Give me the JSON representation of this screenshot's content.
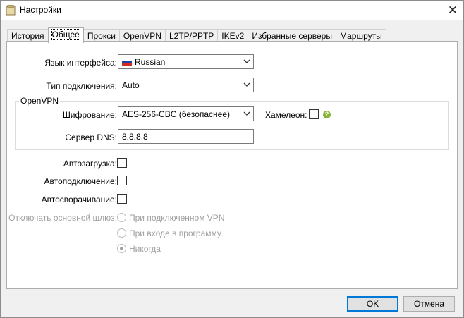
{
  "window": {
    "title": "Настройки",
    "close_glyph": "✕"
  },
  "tabs": [
    {
      "label": "История"
    },
    {
      "label": "Общее"
    },
    {
      "label": "Прокси"
    },
    {
      "label": "OpenVPN"
    },
    {
      "label": "L2TP/PPTP"
    },
    {
      "label": "IKEv2"
    },
    {
      "label": "Избранные серверы"
    },
    {
      "label": "Маршруты"
    }
  ],
  "active_tab": "Общее",
  "general": {
    "language_label": "Язык интерфейса:",
    "language_value": "Russian",
    "connection_type_label": "Тип подключения:",
    "connection_type_value": "Auto"
  },
  "openvpn": {
    "group_title": "OpenVPN",
    "encryption_label": "Шифрование:",
    "encryption_value": "AES-256-CBC (безопаснее)",
    "chameleon_label": "Хамелеон:",
    "chameleon_checked": false,
    "help_glyph": "?",
    "dns_label": "Сервер DNS:",
    "dns_value": "8.8.8.8"
  },
  "options": {
    "autoload_label": "Автозагрузка:",
    "autoconnect_label": "Автоподключение:",
    "autominimize_label": "Автосворачивание:",
    "gateway_label": "Отключать основной шлюз:",
    "gateway_options": [
      {
        "label": "При подключенном VPN",
        "checked": false
      },
      {
        "label": "При входе в программу",
        "checked": false
      },
      {
        "label": "Никогда",
        "checked": true
      }
    ]
  },
  "buttons": {
    "ok": "OK",
    "cancel": "Отмена"
  },
  "colors": {
    "accent": "#0078d7",
    "help": "#86b433"
  }
}
